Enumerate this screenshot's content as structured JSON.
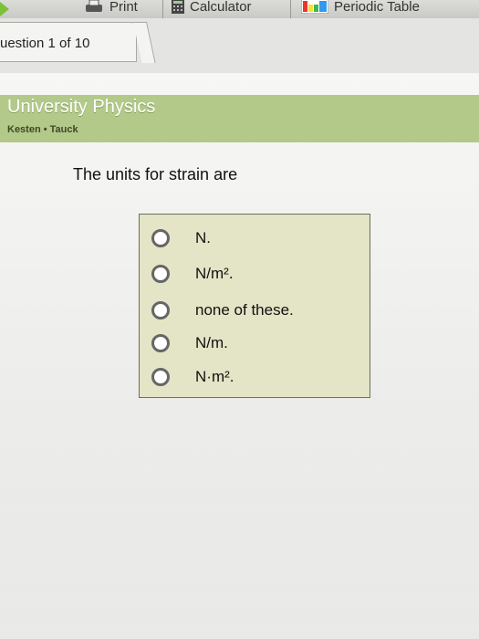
{
  "toolbar": {
    "print_label": "Print",
    "calculator_label": "Calculator",
    "periodic_label": "Periodic Table"
  },
  "question_tab": "uestion 1 of 10",
  "banner": {
    "title": "University Physics",
    "authors": "Kesten • Tauck"
  },
  "question": {
    "text": "The units for strain are",
    "options": [
      {
        "label": "N.",
        "selected": false
      },
      {
        "label": "N/m².",
        "selected": false
      },
      {
        "label": "none of these.",
        "selected": false
      },
      {
        "label": "N/m.",
        "selected": false
      },
      {
        "label": "N·m².",
        "selected": false
      }
    ]
  },
  "colors": {
    "banner": "#b3c98a",
    "answer_box": "#e4e4c6"
  }
}
